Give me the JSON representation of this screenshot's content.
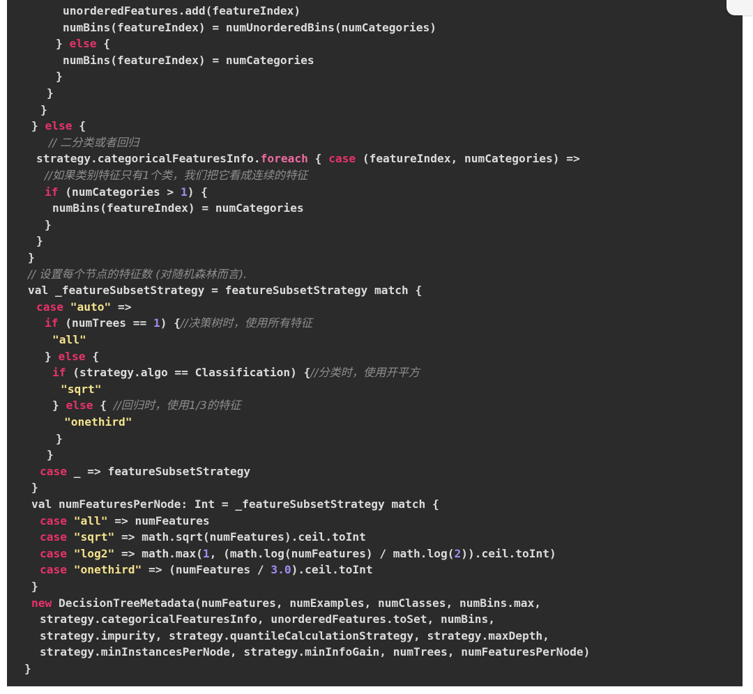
{
  "code_lines": [
    {
      "indent": 90,
      "text": "unorderedFeatures.add(featureIndex)"
    },
    {
      "indent": 90,
      "text": "numBins(featureIndex) = numUnorderedBins(numCategories)"
    },
    {
      "indent": 80,
      "text": "} else {"
    },
    {
      "indent": 90,
      "text": "numBins(featureIndex) = numCategories"
    },
    {
      "indent": 80,
      "text": "}"
    },
    {
      "indent": 67,
      "text": "}"
    },
    {
      "indent": 58,
      "text": "}"
    },
    {
      "indent": 45,
      "text": "} else {"
    },
    {
      "indent": 70,
      "text": "// 二分类或者回归"
    },
    {
      "indent": 52,
      "text": "strategy.categoricalFeaturesInfo.foreach { case (featureIndex, numCategories) =>"
    },
    {
      "indent": 64,
      "text": "//如果类别特征只有1个类，我们把它看成连续的特征"
    },
    {
      "indent": 64,
      "text": "if (numCategories > 1) {"
    },
    {
      "indent": 75,
      "text": "numBins(featureIndex) = numCategories"
    },
    {
      "indent": 64,
      "text": "}"
    },
    {
      "indent": 52,
      "text": "}"
    },
    {
      "indent": 40,
      "text": "}"
    },
    {
      "indent": 40,
      "text": "// 设置每个节点的特征数 (对随机森林而言)."
    },
    {
      "indent": 40,
      "text": "val _featureSubsetStrategy = featureSubsetStrategy match {"
    },
    {
      "indent": 52,
      "text": "case \"auto\" =>"
    },
    {
      "indent": 64,
      "text": "if (numTrees == 1) {//决策树时，使用所有特征"
    },
    {
      "indent": 75,
      "text": "\"all\""
    },
    {
      "indent": 64,
      "text": "} else {"
    },
    {
      "indent": 75,
      "text": "if (strategy.algo == Classification) {//分类时，使用开平方"
    },
    {
      "indent": 87,
      "text": "\"sqrt\""
    },
    {
      "indent": 75,
      "text": "} else { //回归时，使用1/3的特征"
    },
    {
      "indent": 92,
      "text": "\"onethird\""
    },
    {
      "indent": 80,
      "text": "}"
    },
    {
      "indent": 67,
      "text": "}"
    },
    {
      "indent": 57,
      "text": "case _ => featureSubsetStrategy"
    },
    {
      "indent": 45,
      "text": "}"
    },
    {
      "indent": 45,
      "text": "val numFeaturesPerNode: Int = _featureSubsetStrategy match {"
    },
    {
      "indent": 57,
      "text": "case \"all\" => numFeatures"
    },
    {
      "indent": 57,
      "text": "case \"sqrt\" => math.sqrt(numFeatures).ceil.toInt"
    },
    {
      "indent": 57,
      "text": "case \"log2\" => math.max(1, (math.log(numFeatures) / math.log(2)).ceil.toInt)"
    },
    {
      "indent": 57,
      "text": "case \"onethird\" => (numFeatures / 3.0).ceil.toInt"
    },
    {
      "indent": 45,
      "text": "}"
    },
    {
      "indent": 45,
      "text": "new DecisionTreeMetadata(numFeatures, numExamples, numClasses, numBins.max,"
    },
    {
      "indent": 57,
      "text": "strategy.categoricalFeaturesInfo, unorderedFeatures.toSet, numBins,"
    },
    {
      "indent": 57,
      "text": "strategy.impurity, strategy.quantileCalculationStrategy, strategy.maxDepth,"
    },
    {
      "indent": 57,
      "text": "strategy.minInstancesPerNode, strategy.minInfoGain, numTrees, numFeaturesPerNode)"
    },
    {
      "indent": 35,
      "text": "}"
    }
  ],
  "colors": {
    "background": "#2b2b2b",
    "keyword": "#e8336a",
    "string": "#f5e38c",
    "number": "#a48cf0",
    "comment": "#8e8e8e",
    "text": "#dcdcdc"
  }
}
